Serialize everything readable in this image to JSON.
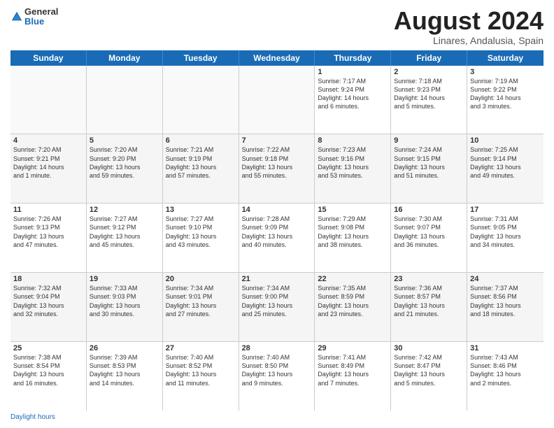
{
  "header": {
    "logo_general": "General",
    "logo_blue": "Blue",
    "title": "August 2024",
    "location": "Linares, Andalusia, Spain"
  },
  "days_of_week": [
    "Sunday",
    "Monday",
    "Tuesday",
    "Wednesday",
    "Thursday",
    "Friday",
    "Saturday"
  ],
  "footer": {
    "label": "Daylight hours"
  },
  "weeks": [
    [
      {
        "day": "",
        "info": ""
      },
      {
        "day": "",
        "info": ""
      },
      {
        "day": "",
        "info": ""
      },
      {
        "day": "",
        "info": ""
      },
      {
        "day": "1",
        "info": "Sunrise: 7:17 AM\nSunset: 9:24 PM\nDaylight: 14 hours\nand 6 minutes."
      },
      {
        "day": "2",
        "info": "Sunrise: 7:18 AM\nSunset: 9:23 PM\nDaylight: 14 hours\nand 5 minutes."
      },
      {
        "day": "3",
        "info": "Sunrise: 7:19 AM\nSunset: 9:22 PM\nDaylight: 14 hours\nand 3 minutes."
      }
    ],
    [
      {
        "day": "4",
        "info": "Sunrise: 7:20 AM\nSunset: 9:21 PM\nDaylight: 14 hours\nand 1 minute."
      },
      {
        "day": "5",
        "info": "Sunrise: 7:20 AM\nSunset: 9:20 PM\nDaylight: 13 hours\nand 59 minutes."
      },
      {
        "day": "6",
        "info": "Sunrise: 7:21 AM\nSunset: 9:19 PM\nDaylight: 13 hours\nand 57 minutes."
      },
      {
        "day": "7",
        "info": "Sunrise: 7:22 AM\nSunset: 9:18 PM\nDaylight: 13 hours\nand 55 minutes."
      },
      {
        "day": "8",
        "info": "Sunrise: 7:23 AM\nSunset: 9:16 PM\nDaylight: 13 hours\nand 53 minutes."
      },
      {
        "day": "9",
        "info": "Sunrise: 7:24 AM\nSunset: 9:15 PM\nDaylight: 13 hours\nand 51 minutes."
      },
      {
        "day": "10",
        "info": "Sunrise: 7:25 AM\nSunset: 9:14 PM\nDaylight: 13 hours\nand 49 minutes."
      }
    ],
    [
      {
        "day": "11",
        "info": "Sunrise: 7:26 AM\nSunset: 9:13 PM\nDaylight: 13 hours\nand 47 minutes."
      },
      {
        "day": "12",
        "info": "Sunrise: 7:27 AM\nSunset: 9:12 PM\nDaylight: 13 hours\nand 45 minutes."
      },
      {
        "day": "13",
        "info": "Sunrise: 7:27 AM\nSunset: 9:10 PM\nDaylight: 13 hours\nand 43 minutes."
      },
      {
        "day": "14",
        "info": "Sunrise: 7:28 AM\nSunset: 9:09 PM\nDaylight: 13 hours\nand 40 minutes."
      },
      {
        "day": "15",
        "info": "Sunrise: 7:29 AM\nSunset: 9:08 PM\nDaylight: 13 hours\nand 38 minutes."
      },
      {
        "day": "16",
        "info": "Sunrise: 7:30 AM\nSunset: 9:07 PM\nDaylight: 13 hours\nand 36 minutes."
      },
      {
        "day": "17",
        "info": "Sunrise: 7:31 AM\nSunset: 9:05 PM\nDaylight: 13 hours\nand 34 minutes."
      }
    ],
    [
      {
        "day": "18",
        "info": "Sunrise: 7:32 AM\nSunset: 9:04 PM\nDaylight: 13 hours\nand 32 minutes."
      },
      {
        "day": "19",
        "info": "Sunrise: 7:33 AM\nSunset: 9:03 PM\nDaylight: 13 hours\nand 30 minutes."
      },
      {
        "day": "20",
        "info": "Sunrise: 7:34 AM\nSunset: 9:01 PM\nDaylight: 13 hours\nand 27 minutes."
      },
      {
        "day": "21",
        "info": "Sunrise: 7:34 AM\nSunset: 9:00 PM\nDaylight: 13 hours\nand 25 minutes."
      },
      {
        "day": "22",
        "info": "Sunrise: 7:35 AM\nSunset: 8:59 PM\nDaylight: 13 hours\nand 23 minutes."
      },
      {
        "day": "23",
        "info": "Sunrise: 7:36 AM\nSunset: 8:57 PM\nDaylight: 13 hours\nand 21 minutes."
      },
      {
        "day": "24",
        "info": "Sunrise: 7:37 AM\nSunset: 8:56 PM\nDaylight: 13 hours\nand 18 minutes."
      }
    ],
    [
      {
        "day": "25",
        "info": "Sunrise: 7:38 AM\nSunset: 8:54 PM\nDaylight: 13 hours\nand 16 minutes."
      },
      {
        "day": "26",
        "info": "Sunrise: 7:39 AM\nSunset: 8:53 PM\nDaylight: 13 hours\nand 14 minutes."
      },
      {
        "day": "27",
        "info": "Sunrise: 7:40 AM\nSunset: 8:52 PM\nDaylight: 13 hours\nand 11 minutes."
      },
      {
        "day": "28",
        "info": "Sunrise: 7:40 AM\nSunset: 8:50 PM\nDaylight: 13 hours\nand 9 minutes."
      },
      {
        "day": "29",
        "info": "Sunrise: 7:41 AM\nSunset: 8:49 PM\nDaylight: 13 hours\nand 7 minutes."
      },
      {
        "day": "30",
        "info": "Sunrise: 7:42 AM\nSunset: 8:47 PM\nDaylight: 13 hours\nand 5 minutes."
      },
      {
        "day": "31",
        "info": "Sunrise: 7:43 AM\nSunset: 8:46 PM\nDaylight: 13 hours\nand 2 minutes."
      }
    ]
  ]
}
